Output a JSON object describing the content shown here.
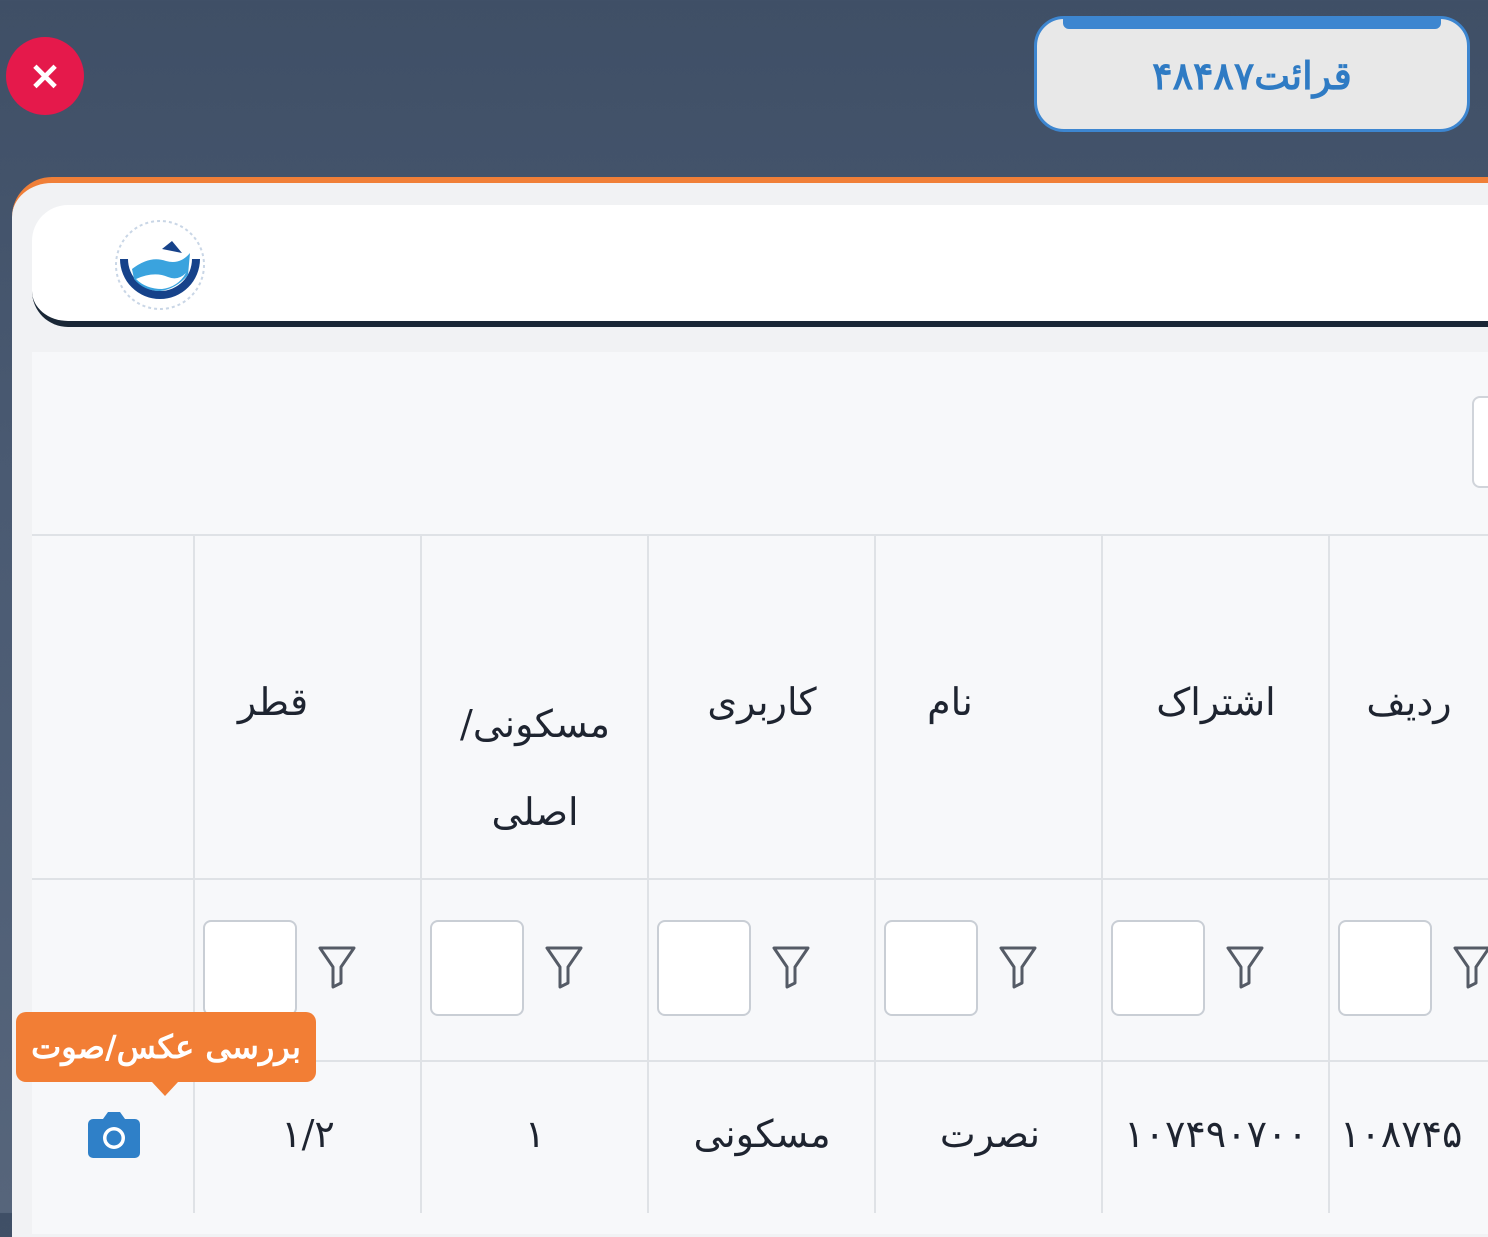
{
  "close": {
    "symbol": "×"
  },
  "reading": {
    "label": "قرائت۴۸۴۸۷"
  },
  "columns": [
    {
      "key": "radif",
      "label": "ردیف"
    },
    {
      "key": "eshterak",
      "label": "اشتراک"
    },
    {
      "key": "name",
      "label": "نام"
    },
    {
      "key": "karbari",
      "label": "کاربری"
    },
    {
      "key": "maskooni",
      "label": "مسکونی/ اصلی"
    },
    {
      "key": "ghotr",
      "label": "قطر"
    }
  ],
  "row": {
    "radif": "۱۰۸۷۴۵",
    "eshterak": "۱۰۷۴۹۰۷۰۰",
    "name": "نصرت",
    "karbari": "مسکونی",
    "maskooni": "۱",
    "ghotr": "۱/۲"
  },
  "tooltip": {
    "label": "بررسی عکس/صوت"
  },
  "icons": {
    "close": "close-icon",
    "filter": "filter-icon",
    "camera": "camera-icon",
    "logo": "water-company-logo"
  },
  "colors": {
    "accent_blue": "#3d86d0",
    "close_red": "#e5194b",
    "panel_orange": "#f07f38",
    "tooltip_orange": "#f27e35"
  }
}
